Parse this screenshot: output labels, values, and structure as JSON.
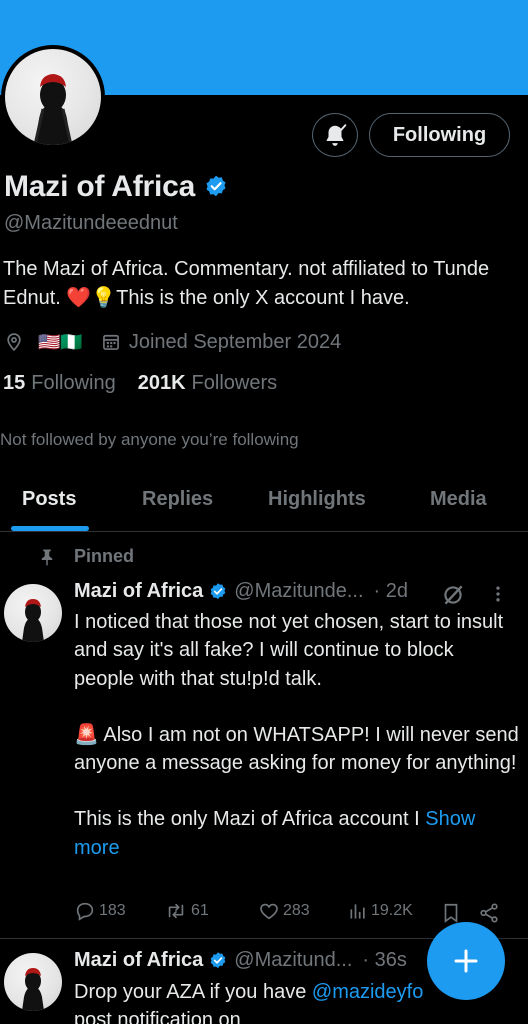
{
  "profile": {
    "display_name": "Mazi of Africa",
    "handle": "@Mazitundeeednut",
    "bio": "The Mazi of Africa. Commentary. not affiliated to Tunde Ednut. ❤️💡This is the only X account I have.",
    "flags": "🇺🇸🇳🇬",
    "joined": "Joined September 2024",
    "following_count": "15",
    "following_label": "Following",
    "followers_count": "201K",
    "followers_label": "Followers",
    "not_followed_text": "Not followed by anyone you’re following",
    "follow_button_label": "Following"
  },
  "tabs": [
    {
      "label": "Posts",
      "active": true
    },
    {
      "label": "Replies",
      "active": false
    },
    {
      "label": "Highlights",
      "active": false
    },
    {
      "label": "Media",
      "active": false
    }
  ],
  "pinned_post": {
    "pinned_label": "Pinned",
    "name": "Mazi of Africa",
    "handle": "@Mazitunde...",
    "time": "· 2d",
    "text_p1": "I noticed that those not yet chosen, start to insult and say it's all fake?  I will continue to block people with that stu!p!d talk.",
    "text_p2": "🚨 Also I am not on WHATSAPP! I will never send anyone a message asking for money for anything!",
    "text_p3": "This is the only Mazi of Africa account I ",
    "show_more": "Show more",
    "replies": "183",
    "reposts": "61",
    "likes": "283",
    "views": "19.2K"
  },
  "second_post": {
    "name": "Mazi of Africa",
    "handle": "@Mazitund...",
    "time": "· 36s",
    "text_start": "Drop your AZA if you have ",
    "mention": "@mazideyfo",
    "text_line2": "post notification on"
  },
  "colors": {
    "accent": "#1d9bf0",
    "background": "#000000",
    "muted": "#71767b"
  },
  "icons": [
    "bell-check-icon",
    "verified-badge-icon",
    "location-icon",
    "calendar-icon",
    "pin-icon",
    "grok-slash-icon",
    "more-icon",
    "reply-icon",
    "repost-icon",
    "like-icon",
    "views-icon",
    "bookmark-icon",
    "share-icon",
    "plus-icon"
  ]
}
